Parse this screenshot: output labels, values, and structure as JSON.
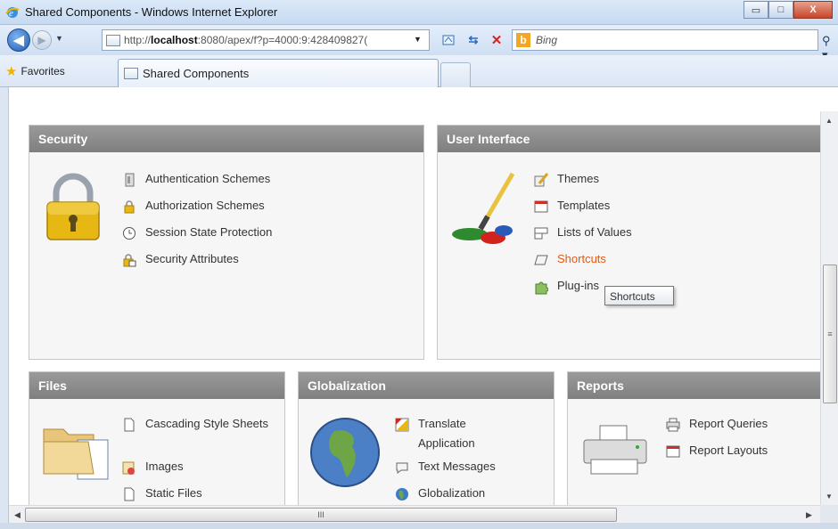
{
  "window": {
    "title": "Shared Components - Windows Internet Explorer",
    "minimize": "▭",
    "maximize": "□",
    "close": "X"
  },
  "nav": {
    "url_prefix": "http://",
    "url_host": "localhost",
    "url_rest": ":8080/apex/f?p=4000:9:428409827(",
    "search_placeholder": "Bing"
  },
  "favorites": {
    "label": "Favorites",
    "tab_label": "Shared Components"
  },
  "panels": {
    "security": {
      "title": "Security",
      "items": [
        {
          "label": "Authentication Schemes",
          "icon": "id-card-icon"
        },
        {
          "label": "Authorization Schemes",
          "icon": "padlock-small-icon"
        },
        {
          "label": "Session State Protection",
          "icon": "clock-icon"
        },
        {
          "label": "Security Attributes",
          "icon": "lock-grid-icon"
        }
      ]
    },
    "user_interface": {
      "title": "User Interface",
      "items": [
        {
          "label": "Themes",
          "icon": "paintbrush-icon"
        },
        {
          "label": "Templates",
          "icon": "template-icon"
        },
        {
          "label": "Lists of Values",
          "icon": "list-icon"
        },
        {
          "label": "Shortcuts",
          "icon": "shortcut-icon"
        },
        {
          "label": "Plug-ins",
          "icon": "puzzle-icon"
        }
      ]
    },
    "files": {
      "title": "Files",
      "items": [
        {
          "label": "Cascading Style Sheets",
          "icon": "css-file-icon"
        },
        {
          "label": "Images",
          "icon": "image-file-icon"
        },
        {
          "label": "Static Files",
          "icon": "file-icon"
        }
      ]
    },
    "globalization": {
      "title": "Globalization",
      "items": [
        {
          "label": "Translate Application",
          "icon": "translate-icon"
        },
        {
          "label": "Text Messages",
          "icon": "speech-bubble-icon"
        },
        {
          "label": "Globalization",
          "icon": "globe-small-icon"
        }
      ]
    },
    "reports": {
      "title": "Reports",
      "items": [
        {
          "label": "Report Queries",
          "icon": "printer-small-icon"
        },
        {
          "label": "Report Layouts",
          "icon": "layout-icon"
        }
      ]
    }
  },
  "tooltip": "Shortcuts",
  "scroll": {
    "h_grip": "III",
    "v_grip": "≡"
  },
  "colors": {
    "panel_header": "#8a8a8a",
    "link_hover": "#e05a1a"
  }
}
